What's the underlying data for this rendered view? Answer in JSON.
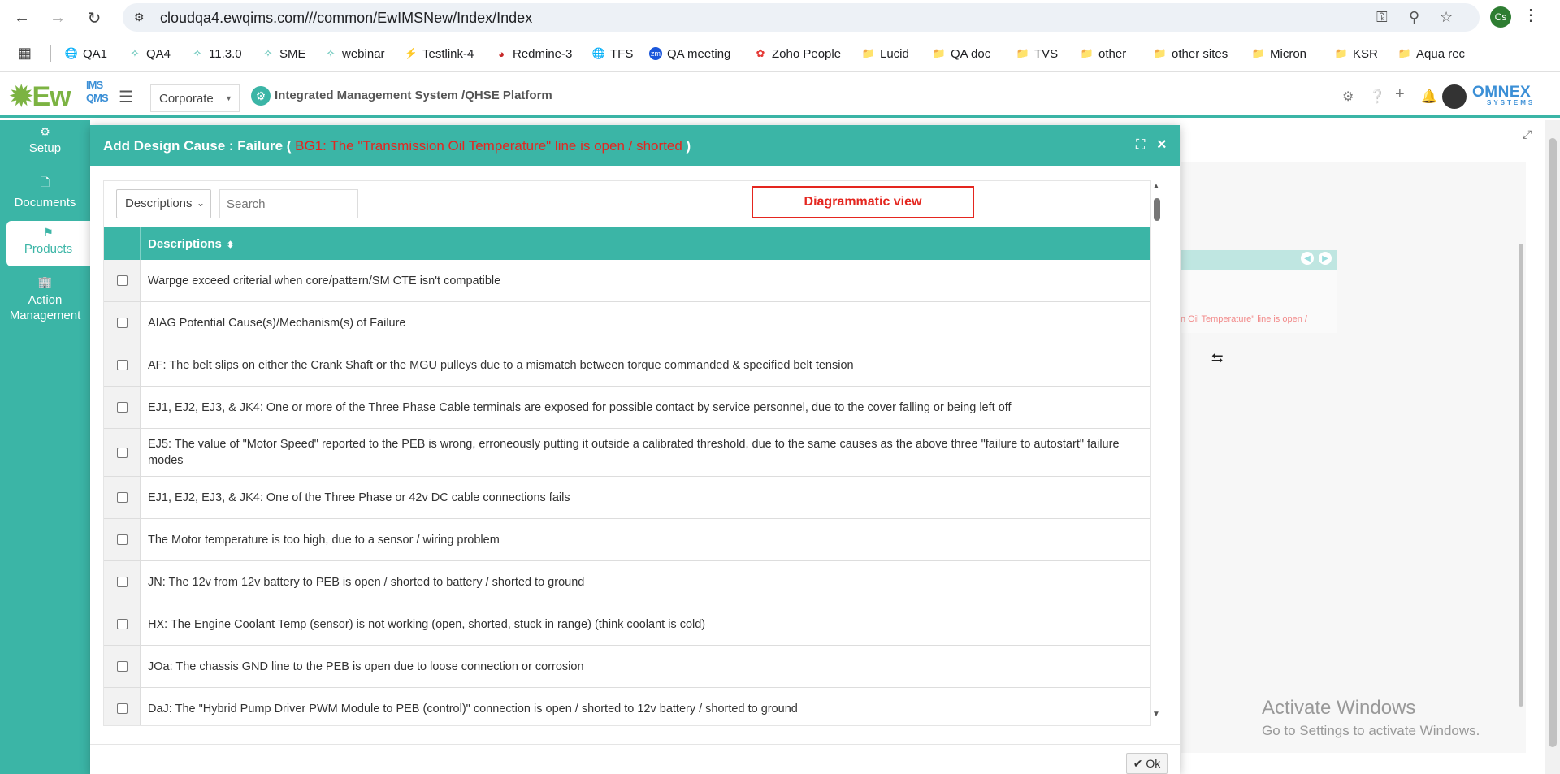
{
  "browser": {
    "url": "cloudqa4.ewqims.com///common/EwIMSNew/Index/Index",
    "profile_initials": "Cs",
    "bookmarks": [
      {
        "label": "QA1"
      },
      {
        "label": "QA4"
      },
      {
        "label": "11.3.0"
      },
      {
        "label": "SME"
      },
      {
        "label": "webinar"
      },
      {
        "label": "Testlink-4"
      },
      {
        "label": "Redmine-3"
      },
      {
        "label": "TFS"
      },
      {
        "label": "QA meeting"
      },
      {
        "label": "Zoho People"
      },
      {
        "label": "Lucid"
      },
      {
        "label": "QA doc"
      },
      {
        "label": "TVS"
      },
      {
        "label": "other"
      },
      {
        "label": "other sites"
      },
      {
        "label": "Micron"
      },
      {
        "label": "KSR"
      },
      {
        "label": "Aqua rec"
      }
    ]
  },
  "app": {
    "logo_text": "Ew",
    "logo_ims": "IMS",
    "logo_qms": "QMS",
    "site_select": "Corporate",
    "platform_title": "Integrated Management System /QHSE Platform",
    "brand": "OMNEX",
    "brand_sub": "SYSTEMS",
    "accent_color": "#3bb5a6"
  },
  "sidebar": {
    "items": [
      {
        "label": "Setup",
        "icon": "gears-icon"
      },
      {
        "label": "Documents",
        "icon": "documents-icon"
      },
      {
        "label": "Products",
        "icon": "products-icon"
      },
      {
        "label": "Action Management",
        "icon": "building-icon"
      }
    ]
  },
  "background": {
    "card_text": "n Oil Temperature\" line is open /"
  },
  "modal": {
    "title_prefix": "Add Design Cause : Failure ( ",
    "title_highlight": "BG1: The \"Transmission Oil Temperature\" line is open / shorted",
    "title_suffix": " )",
    "filter_select": "Descriptions",
    "search_placeholder": "Search",
    "diagrammatic_label": "Diagrammatic view",
    "column_header": "Descriptions",
    "ok_label": "Ok",
    "rows": [
      {
        "text": "Warpge exceed criterial when core/pattern/SM CTE isn't compatible",
        "checked": false
      },
      {
        "text": "AIAG Potential Cause(s)/Mechanism(s) of Failure",
        "checked": false
      },
      {
        "text": "AF: The belt slips on either the Crank Shaft or the MGU pulleys due to a mismatch between torque commanded & specified belt tension",
        "checked": false
      },
      {
        "text": "EJ1, EJ2, EJ3, & JK4: One or more of the Three Phase Cable terminals are exposed for possible contact by service personnel, due to the cover falling or being left off",
        "checked": false
      },
      {
        "text": "EJ5: The value of \"Motor Speed\" reported to the PEB is wrong, erroneously putting it outside a calibrated threshold, due to the same causes as the above three \"failure to autostart\" failure modes",
        "checked": false
      },
      {
        "text": "EJ1, EJ2, EJ3, & JK4: One of the Three Phase or 42v DC cable connections fails",
        "checked": false
      },
      {
        "text": "The Motor temperature is too high, due to a sensor / wiring problem",
        "checked": false
      },
      {
        "text": "JN: The 12v from 12v battery to PEB is open / shorted to battery / shorted to ground",
        "checked": false
      },
      {
        "text": "HX: The Engine Coolant Temp (sensor) is not working (open, shorted, stuck in range) (think coolant is cold)",
        "checked": false
      },
      {
        "text": "JOa: The chassis GND line to the PEB is open due to loose connection or corrosion",
        "checked": false
      },
      {
        "text": "DaJ: The \"Hybrid Pump Driver PWM Module to PEB (control)\" connection is open / shorted to 12v battery / shorted to ground",
        "checked": false
      }
    ]
  },
  "watermark": {
    "line1": "Activate Windows",
    "line2": "Go to Settings to activate Windows."
  }
}
